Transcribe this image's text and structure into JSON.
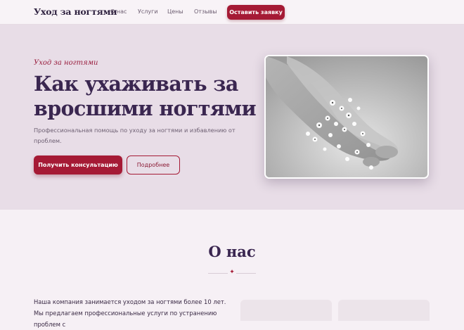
{
  "header": {
    "logo": "Уход за ногтями",
    "nav": [
      "О нас",
      "Услуги",
      "Цены",
      "Отзывы"
    ],
    "cta": "Оставить заявку"
  },
  "hero": {
    "eyebrow": "Уход за ногтями",
    "title_line1": "Как ухаживать за",
    "title_line2": "вросшими ногтями",
    "subtitle": "Профессиональная помощь по уходу за ногтями и избавлению от проблем.",
    "primary_button": "Получить консультацию",
    "secondary_button": "Подробнее"
  },
  "about": {
    "title": "О нас",
    "divider_icon": "✦",
    "text": "Наша компания занимается уходом за ногтями более 10 лет. Мы предлагаем профессиональные услуги по устранению проблем с"
  }
}
